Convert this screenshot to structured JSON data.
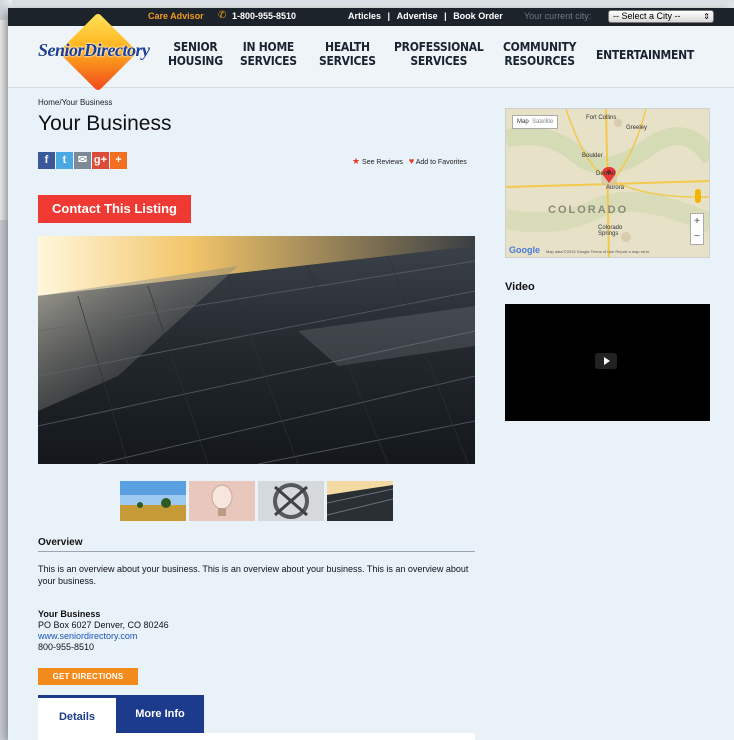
{
  "topbar": {
    "care_advisor": "Care Advisor",
    "phone": "1-800-955-8510",
    "links": [
      "Articles",
      "Advertise",
      "Book Order"
    ],
    "separator": "|",
    "city_label": "Your current city:",
    "city_select": "-- Select a City --"
  },
  "logo": {
    "text": "SeniorDirectory"
  },
  "nav": [
    {
      "line1": "SENIOR",
      "line2": "HOUSING"
    },
    {
      "line1": "IN HOME",
      "line2": "SERVICES"
    },
    {
      "line1": "HEALTH",
      "line2": "SERVICES"
    },
    {
      "line1": "PROFESSIONAL",
      "line2": "SERVICES"
    },
    {
      "line1": "COMMUNITY",
      "line2": "RESOURCES"
    },
    {
      "line1": "ENTERTAINMENT",
      "line2": ""
    }
  ],
  "breadcrumb": {
    "home": "Home",
    "separator": "/",
    "current": "Your Business"
  },
  "page_title": "Your Business",
  "share": {
    "facebook": "f",
    "twitter": "t",
    "email": "✉",
    "google": "g+",
    "more": "+"
  },
  "actions": {
    "reviews": "See Reviews",
    "favorites": "Add to Favorites"
  },
  "contact_button": "Contact This Listing",
  "overview": {
    "title": "Overview",
    "text": "This is an overview about your business.  This is an overview about your business.  This is an overview about your business."
  },
  "business": {
    "name": "Your Business",
    "address": "PO Box 6027 Denver, CO 80246",
    "url": "www.seniordirectory.com",
    "phone": "800-955-8510"
  },
  "directions_button": "GET DIRECTIONS",
  "tabs": [
    "Details",
    "More Info"
  ],
  "map": {
    "type_map": "Map",
    "type_satellite": "Satellite",
    "labels": {
      "fort_collins": "Fort Collins",
      "greeley": "Greeley",
      "boulder": "Boulder",
      "denver": "Denver",
      "aurora": "Aurora",
      "colorado_springs": "Colorado Springs",
      "state": "COLORADO"
    },
    "google": "Google",
    "attribution": "Map data ©2015 Google   Terms of Use   Report a map error"
  },
  "video_title": "Video",
  "colors": {
    "accent_red": "#ef3a34",
    "accent_orange": "#f28b1b",
    "navy": "#1d3b8c",
    "page_bg": "#e9f2f9"
  }
}
